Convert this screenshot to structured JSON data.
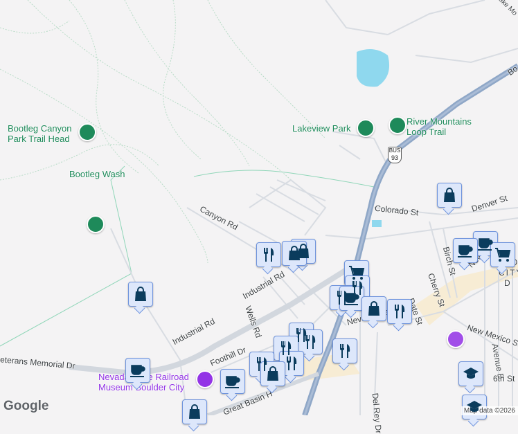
{
  "labels": {
    "bootleg_canyon": [
      "Bootleg Canyon",
      "Park Trail Head"
    ],
    "bootleg_wash": "Bootleg Wash",
    "lakeview_park": "Lakeview Park",
    "river_mountains": [
      "River Mountains",
      "Loop Trail"
    ],
    "lake_mountain": "Lake Mo",
    "canyon_rd": "Canyon Rd",
    "colorado_st": "Colorado St",
    "denver_st": "Denver St",
    "industrial_rd_1": "Industrial Rd",
    "industrial_rd_2": "Industrial Rd",
    "wells_rd": "Wells Rd",
    "foothill_dr": "Foothill Dr",
    "veterans": "eterans Memorial Dr",
    "nevada_way": "Nevada Way",
    "nevada_hwy": "Nev",
    "birch_st": "Birch St",
    "cherry_st": "Cherry St",
    "date_st": "Date St",
    "new_mexico_st": "New Mexico St",
    "avenue_b": "Avenue B",
    "sixth_st": "6th St",
    "del_rey_dr": "Del Rey Dr",
    "great_basin": "Great Basin H",
    "museum": [
      "Nevada State Railroad",
      "Museum Boulder City"
    ],
    "downtown": [
      "BO",
      "CITY",
      "D"
    ],
    "boulder_hwy": "Bo",
    "bus93": [
      "BUS",
      "93"
    ]
  },
  "branding": {
    "logo": "Google",
    "attribution": "Map data ©2026"
  },
  "colors": {
    "marker_bg": "#dde7fb",
    "marker_border": "#6e93dc",
    "icon": "#0b3c5d",
    "park": "#1e8a5a",
    "highway": "#8fa7c7",
    "water": "#8fd8ee"
  },
  "markers": [
    "shopping",
    "food",
    "shopping",
    "shopping",
    "cart",
    "food",
    "coffee",
    "shopping",
    "food",
    "coffee",
    "coffee",
    "cart",
    "food",
    "food",
    "food",
    "food",
    "coffee",
    "shopping",
    "food",
    "food",
    "coffee",
    "shopping",
    "school",
    "school"
  ]
}
